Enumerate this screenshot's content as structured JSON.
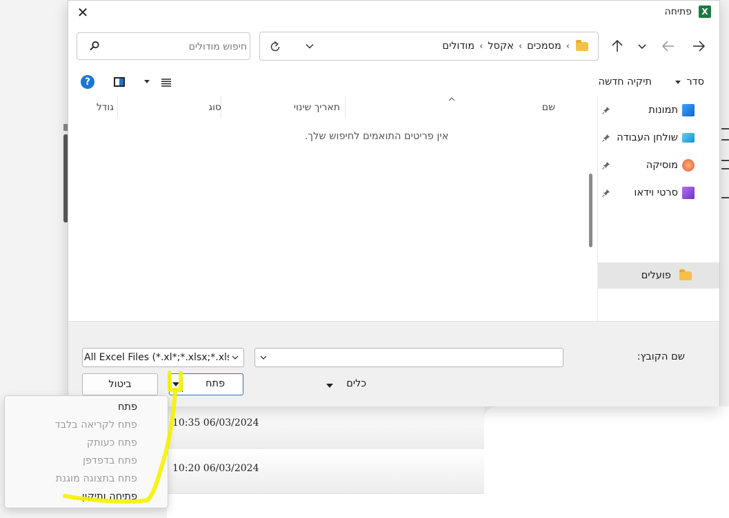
{
  "dialog": {
    "title": "פתיחה",
    "app_icon": "excel-icon",
    "close_icon": "close-icon"
  },
  "search": {
    "placeholder": "חיפוש מודולים",
    "icon": "search-icon"
  },
  "address_bar": {
    "breadcrumb": [
      "מסמכים",
      "אקסל",
      "מודולים"
    ],
    "folder_icon": "folder-icon"
  },
  "nav_buttons": [
    "back-arrow-icon",
    "forward-arrow-icon",
    "recent-dropdown-icon",
    "up-arrow-icon"
  ],
  "command_bar": {
    "organize_label": "סדר",
    "new_folder_label": "תיקיה חדשה"
  },
  "file_list": {
    "columns": [
      "שם",
      "תאריך שינוי",
      "סוג",
      "גודל"
    ],
    "empty_message": "אין פריטים התואמים לחיפוש שלך."
  },
  "nav_pane": {
    "items": [
      {
        "label": "תמונות",
        "icon": "pictures-icon",
        "pinned": true
      },
      {
        "label": "שולחן העבודה",
        "icon": "desktop-icon",
        "pinned": true
      },
      {
        "label": "מוסיקה",
        "icon": "music-icon",
        "pinned": true
      },
      {
        "label": "סרטי וידאו",
        "icon": "videos-icon",
        "pinned": true
      },
      {
        "label": "פועלים",
        "icon": "folder-icon",
        "pinned": false,
        "selected": true
      }
    ]
  },
  "bottom": {
    "filename_label": "שם הקובץ:",
    "filename_value": "",
    "filetype_value": "All Excel Files (*.xl*;*.xlsx;*.xlsm;*",
    "tools_label": "כלים",
    "open_label": "פתח",
    "cancel_label": "ביטול"
  },
  "open_menu": {
    "items": [
      {
        "label": "פתח",
        "enabled": true
      },
      {
        "label": "פתח לקריאה בלבד",
        "enabled": false
      },
      {
        "label": "פתח כעותק",
        "enabled": false
      },
      {
        "label": "פתח בדפדפן",
        "enabled": false
      },
      {
        "label": "פתח בתצוגה מוגנת",
        "enabled": false
      },
      {
        "label": "פתיחה ותיקון...",
        "enabled": true
      }
    ]
  },
  "background_rows": [
    {
      "text": "10:35 06/03/2024"
    },
    {
      "text": "10:20 06/03/2024"
    }
  ],
  "colors": {
    "accent_blue": "#1b76d2",
    "highlight_yellow": "#f5f200",
    "folder_yellow": "#f3c14b"
  }
}
